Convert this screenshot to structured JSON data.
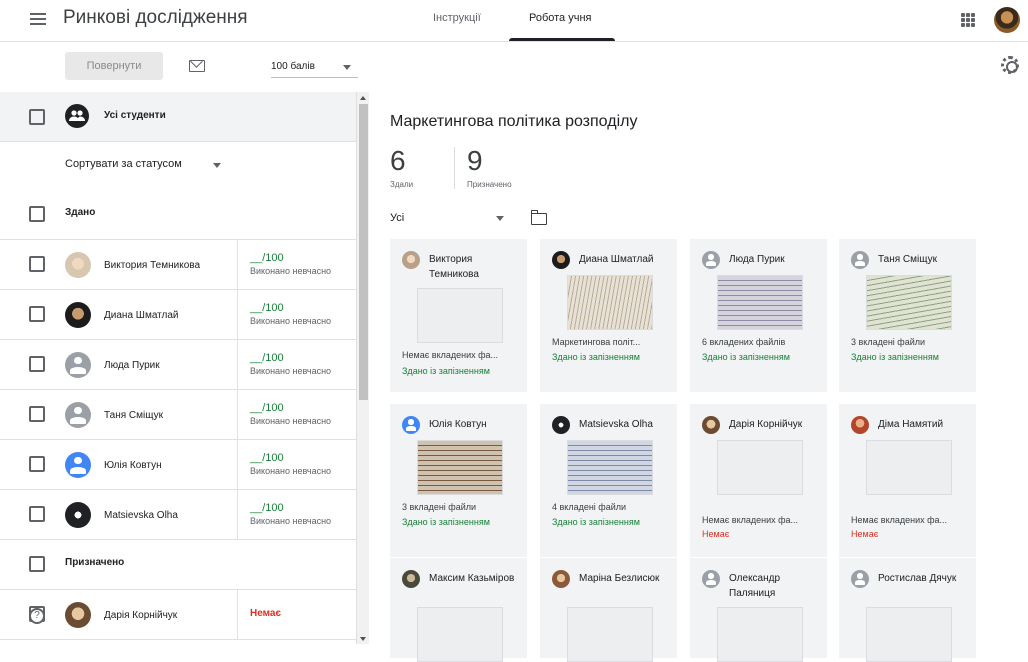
{
  "header": {
    "app_title": "Ринкові дослідження",
    "tabs": [
      "Інструкції",
      "Робота учня"
    ],
    "active_tab": 1
  },
  "toolbar": {
    "return_label": "Повернути",
    "points_value": "100 балів"
  },
  "left": {
    "all_students": "Усі студенти",
    "sort_label": "Сортувати за статусом",
    "group_submitted": "Здано",
    "group_assigned": "Призначено",
    "submitted_rows": [
      {
        "name": "Виктория Темникова",
        "grade": "__/100",
        "sub": "Виконано невчасно"
      },
      {
        "name": "Диана Шматлай",
        "grade": "__/100",
        "sub": "Виконано невчасно"
      },
      {
        "name": "Люда Пурик",
        "grade": "__/100",
        "sub": "Виконано невчасно"
      },
      {
        "name": "Таня Сміщук",
        "grade": "__/100",
        "sub": "Виконано невчасно"
      },
      {
        "name": "Юлія Ковтун",
        "grade": "__/100",
        "sub": "Виконано невчасно"
      },
      {
        "name": "Matsievska Olha",
        "grade": "__/100",
        "sub": "Виконано невчасно"
      }
    ],
    "assigned_rows": [
      {
        "name": "Дарія Корнійчук",
        "status": "Немає"
      }
    ]
  },
  "right": {
    "assignment_title": "Маркетингова політика розподілу",
    "submitted_count": "6",
    "submitted_label": "Здали",
    "assigned_count": "9",
    "assigned_label": "Призначено",
    "filter_value": "Усі",
    "cards": [
      {
        "name": "Виктория Темникова",
        "file": "Немає вкладених фа...",
        "status": "Здано із запізненням",
        "missing": false
      },
      {
        "name": "Диана Шматлай",
        "file": "Маркетингова політ...",
        "status": "Здано із запізненням",
        "missing": false
      },
      {
        "name": "Люда Пурик",
        "file": "6 вкладених файлів",
        "status": "Здано із запізненням",
        "missing": false
      },
      {
        "name": "Таня Сміщук",
        "file": "3 вкладені файли",
        "status": "Здано із запізненням",
        "missing": false
      },
      {
        "name": "Юлія Ковтун",
        "file": "3 вкладені файли",
        "status": "Здано із запізненням",
        "missing": false
      },
      {
        "name": "Matsievska Olha",
        "file": "4 вкладені файли",
        "status": "Здано із запізненням",
        "missing": false
      },
      {
        "name": "Дарія Корнійчук",
        "file": "Немає вкладених фа...",
        "status": "Немає",
        "missing": true
      },
      {
        "name": "Діма Намятий",
        "file": "Немає вкладених фа...",
        "status": "Немає",
        "missing": true
      },
      {
        "name": "Максим Казьміров",
        "file": "",
        "status": "",
        "missing": false
      },
      {
        "name": "Маріна Безлисюк",
        "file": "",
        "status": "",
        "missing": false
      },
      {
        "name": "Олександр Паляниця",
        "file": "",
        "status": "",
        "missing": false
      },
      {
        "name": "Ростислав Дячук",
        "file": "",
        "status": "",
        "missing": false
      }
    ]
  },
  "icons": {
    "menu": "menu-icon",
    "apps": "apps-grid-icon",
    "mail": "mail-icon",
    "settings": "gear-icon",
    "folder": "folder-icon",
    "group": "group-icon",
    "help": "help-icon"
  },
  "colors": {
    "late_green": "#188038",
    "missing_red": "#d93025",
    "card_bg": "#f1f3f4"
  }
}
